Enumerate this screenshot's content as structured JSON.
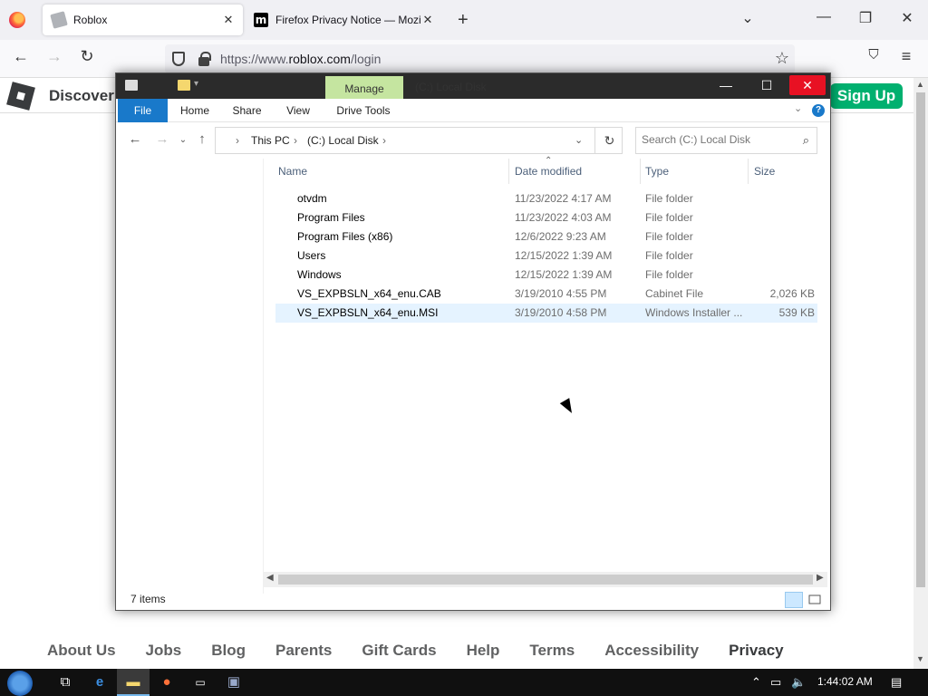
{
  "browser": {
    "tabs": [
      {
        "label": "Roblox",
        "active": true
      },
      {
        "label": "Firefox Privacy Notice — Mozill",
        "active": false
      }
    ],
    "url_prefix": "https://www.",
    "url_domain": "roblox.com",
    "url_path": "/login"
  },
  "roblox": {
    "nav_label": "Discover",
    "signup_label": "Sign Up",
    "footer": [
      "About Us",
      "Jobs",
      "Blog",
      "Parents",
      "Gift Cards",
      "Help",
      "Terms",
      "Accessibility",
      "Privacy"
    ]
  },
  "explorer": {
    "manage_label": "Manage",
    "title": "(C:) Local Disk",
    "ribbon_tabs": [
      "File",
      "Home",
      "Share",
      "View",
      "Drive Tools"
    ],
    "breadcrumb": [
      "This PC",
      "(C:) Local Disk"
    ],
    "search_placeholder": "Search (C:) Local Disk",
    "columns": {
      "name": "Name",
      "date": "Date modified",
      "type": "Type",
      "size": "Size"
    },
    "files": [
      {
        "name": "otvdm",
        "date": "11/23/2022 4:17 AM",
        "type": "File folder",
        "size": ""
      },
      {
        "name": "Program Files",
        "date": "11/23/2022 4:03 AM",
        "type": "File folder",
        "size": ""
      },
      {
        "name": "Program Files (x86)",
        "date": "12/6/2022 9:23 AM",
        "type": "File folder",
        "size": ""
      },
      {
        "name": "Users",
        "date": "12/15/2022 1:39 AM",
        "type": "File folder",
        "size": ""
      },
      {
        "name": "Windows",
        "date": "12/15/2022 1:39 AM",
        "type": "File folder",
        "size": ""
      },
      {
        "name": "VS_EXPBSLN_x64_enu.CAB",
        "date": "3/19/2010 4:55 PM",
        "type": "Cabinet File",
        "size": "2,026 KB"
      },
      {
        "name": "VS_EXPBSLN_x64_enu.MSI",
        "date": "3/19/2010 4:58 PM",
        "type": "Windows Installer ...",
        "size": "539 KB"
      }
    ],
    "selected_index": 6,
    "status": "7 items"
  },
  "taskbar": {
    "clock": "1:44:02 AM"
  },
  "colors": {
    "roblox_green": "#00b06f",
    "file_tab_blue": "#1979ca",
    "manage_green": "#c5e5a0",
    "close_red": "#e81123",
    "selection": "#e5f3ff"
  }
}
